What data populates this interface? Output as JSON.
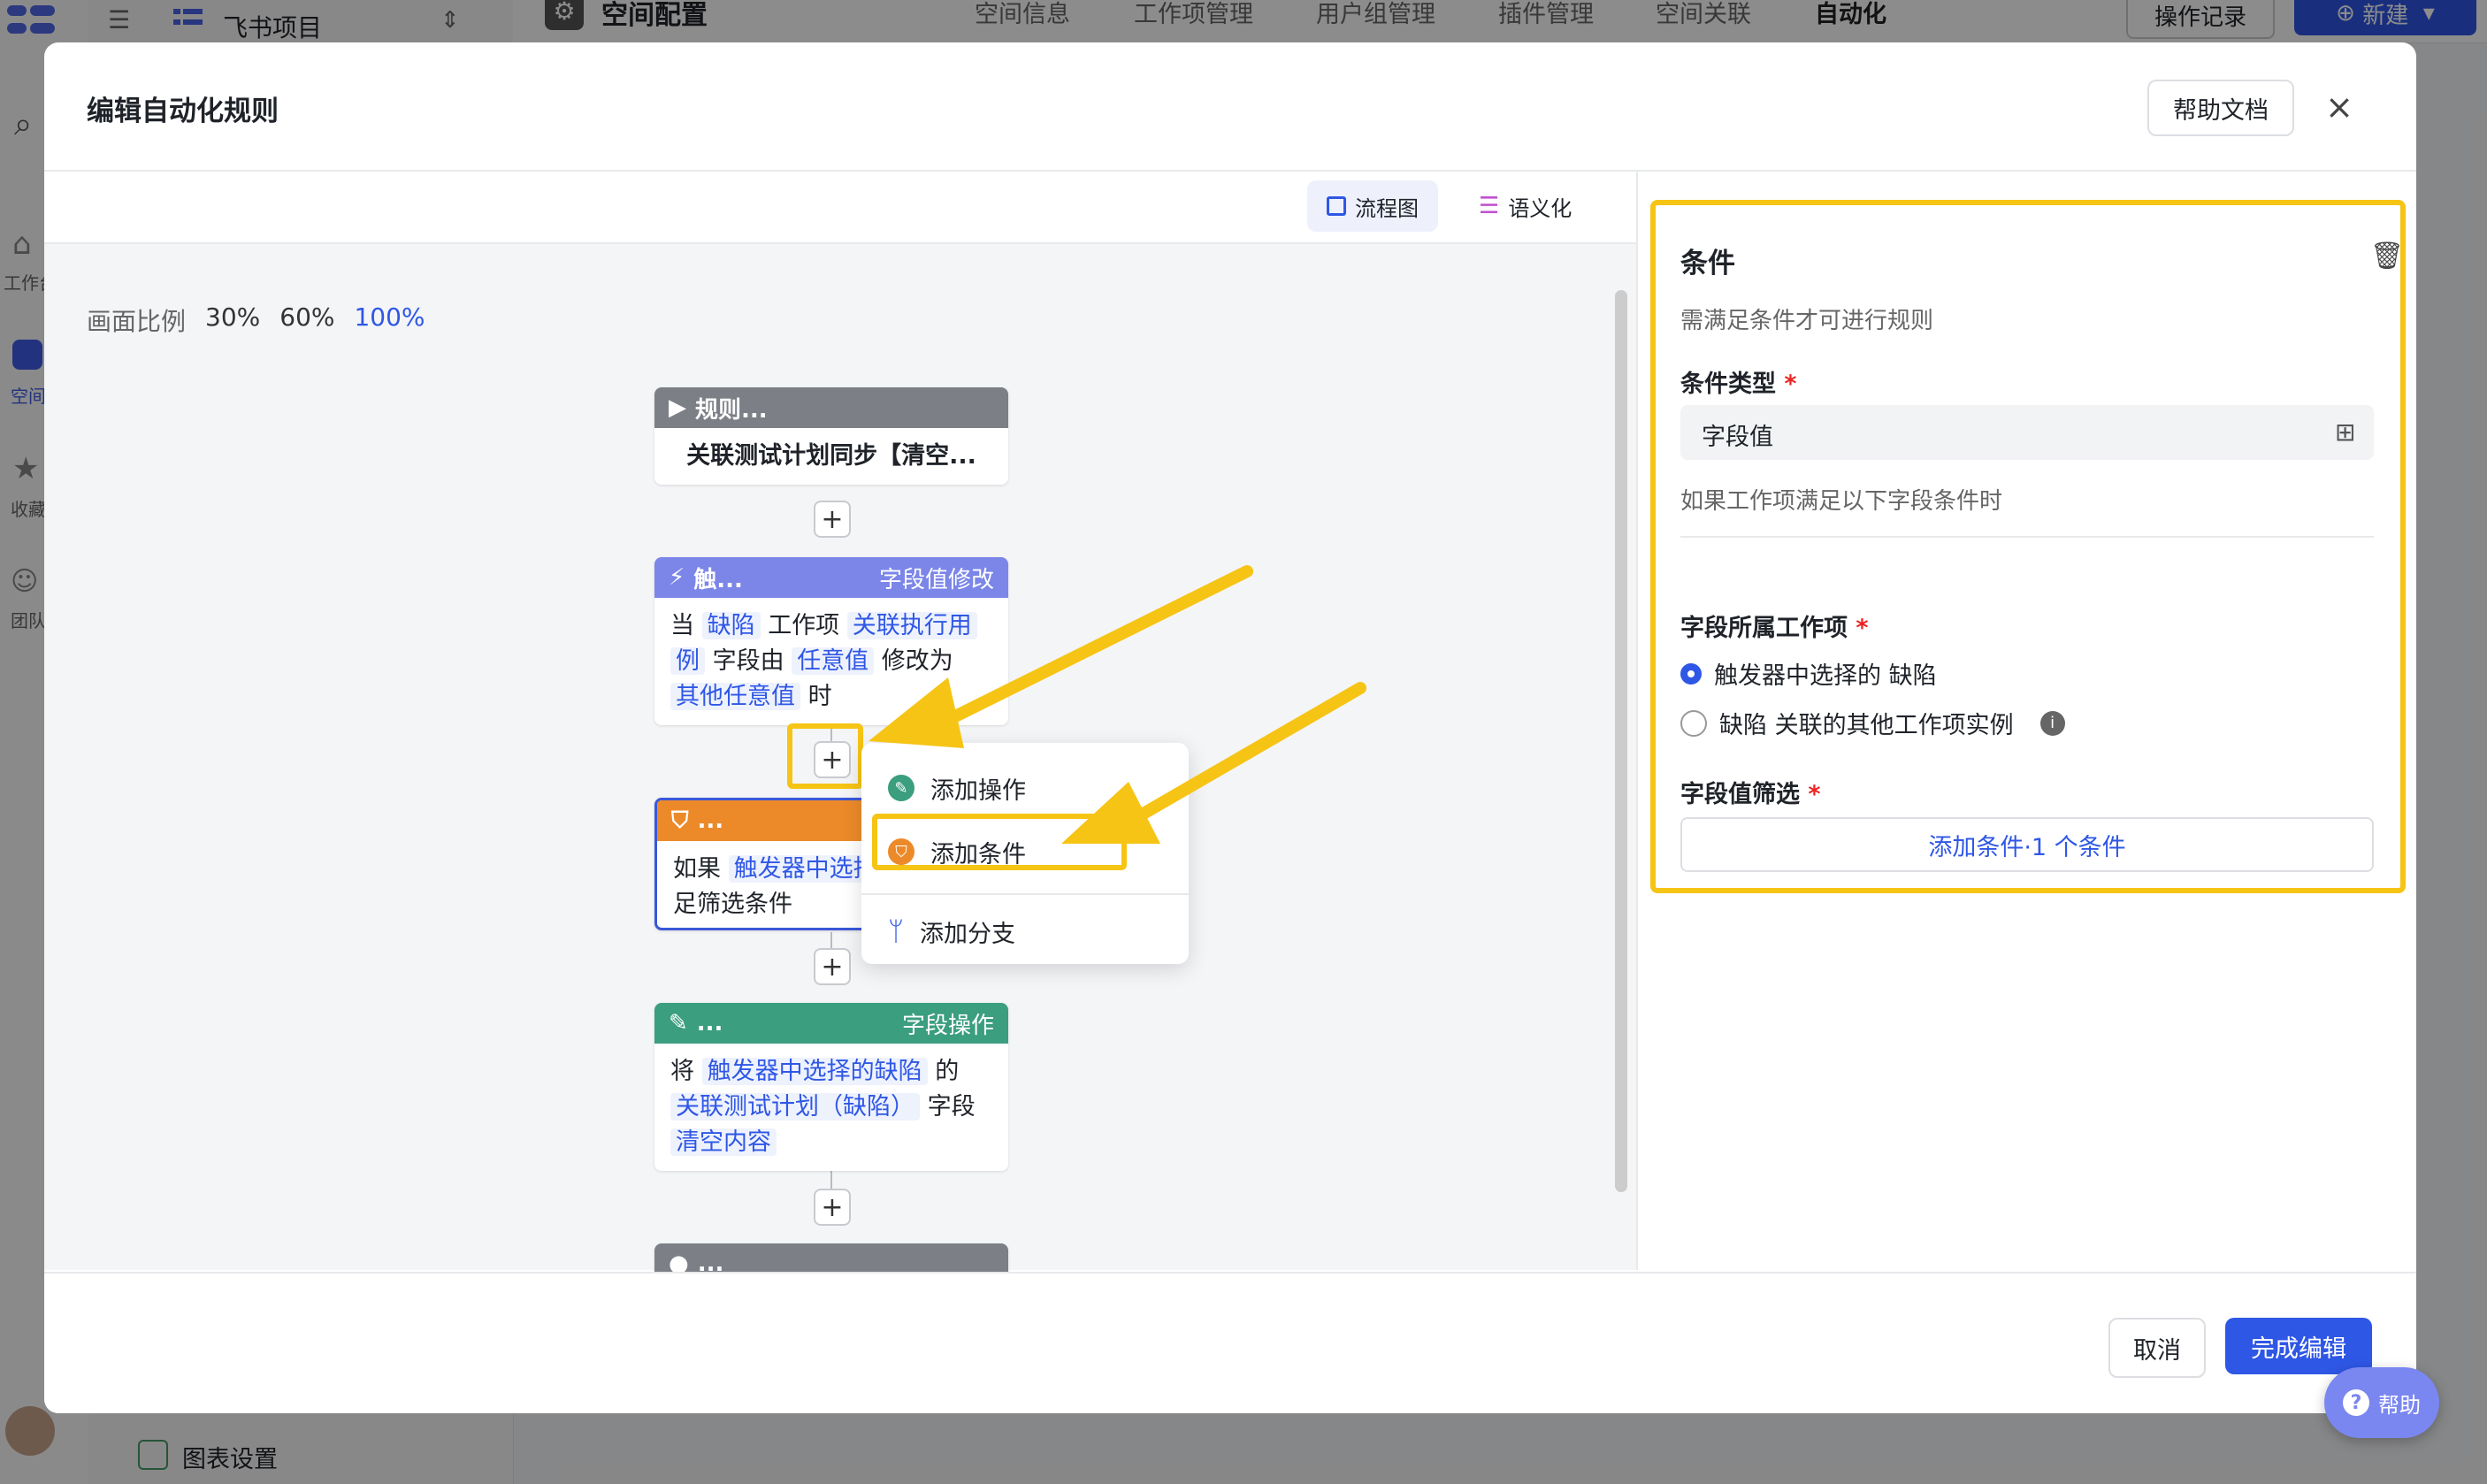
{
  "background": {
    "project_name": "飞书项目",
    "page_title": "空间配置",
    "tabs": [
      "空间信息",
      "工作项管理",
      "用户组管理",
      "插件管理",
      "空间关联",
      "自动化"
    ],
    "active_tab": "自动化",
    "log_button": "操作记录",
    "new_button": "新建",
    "side_labels": [
      "工作台",
      "空间",
      "收藏",
      "团队"
    ],
    "bottom_item": "图表设置"
  },
  "modal": {
    "title": "编辑自动化规则",
    "help_doc": "帮助文档",
    "close": "×"
  },
  "view_tabs": {
    "flow": "流程图",
    "semantic": "语义化"
  },
  "zoom": {
    "label": "画面比例",
    "options": [
      "30%",
      "60%",
      "100%"
    ],
    "active": "100%"
  },
  "nodes": {
    "rule": {
      "head": "规则...",
      "body": "关联测试计划同步【清空..."
    },
    "trigger": {
      "head": "触...",
      "tag": "字段值修改",
      "t1": "当",
      "c1": "缺陷",
      "t2": "工作项",
      "c2": "关联执行用",
      "c3": "例",
      "t3": "字段由",
      "c4": "任意值",
      "t4": "修改为",
      "c5": "其他任意值",
      "t5": "时"
    },
    "condition": {
      "head": "...",
      "t1": "如果",
      "c1": "触发器中选择",
      "t2": "足筛选条件"
    },
    "action": {
      "head": "...",
      "tag": "字段操作",
      "t1": "将",
      "c1": "触发器中选择的缺陷",
      "t2": "的",
      "c2": "关联测试计划（缺陷）",
      "t3": "字段",
      "c3": "清空内容"
    },
    "end": {
      "head": "..."
    }
  },
  "dropdown": {
    "add_action": "添加操作",
    "add_condition": "添加条件",
    "add_branch": "添加分支"
  },
  "panel": {
    "title": "条件",
    "desc": "需满足条件才可进行规则",
    "type_label": "条件类型",
    "type_value": "字段值",
    "type_hint": "如果工作项满足以下字段条件时",
    "owner_label": "字段所属工作项",
    "radio1": "触发器中选择的 缺陷",
    "radio2": "缺陷 关联的其他工作项实例",
    "filter_label": "字段值筛选",
    "filter_button": "添加条件·1 个条件"
  },
  "footer": {
    "cancel": "取消",
    "done": "完成编辑"
  },
  "help_float": "帮助",
  "colors": {
    "accent": "#2f57e6",
    "highlight": "#f6c415",
    "trigger": "#7b86e8",
    "condition": "#ec8a2a",
    "action": "#3b9e7e",
    "gray_node": "#7c7f86"
  }
}
